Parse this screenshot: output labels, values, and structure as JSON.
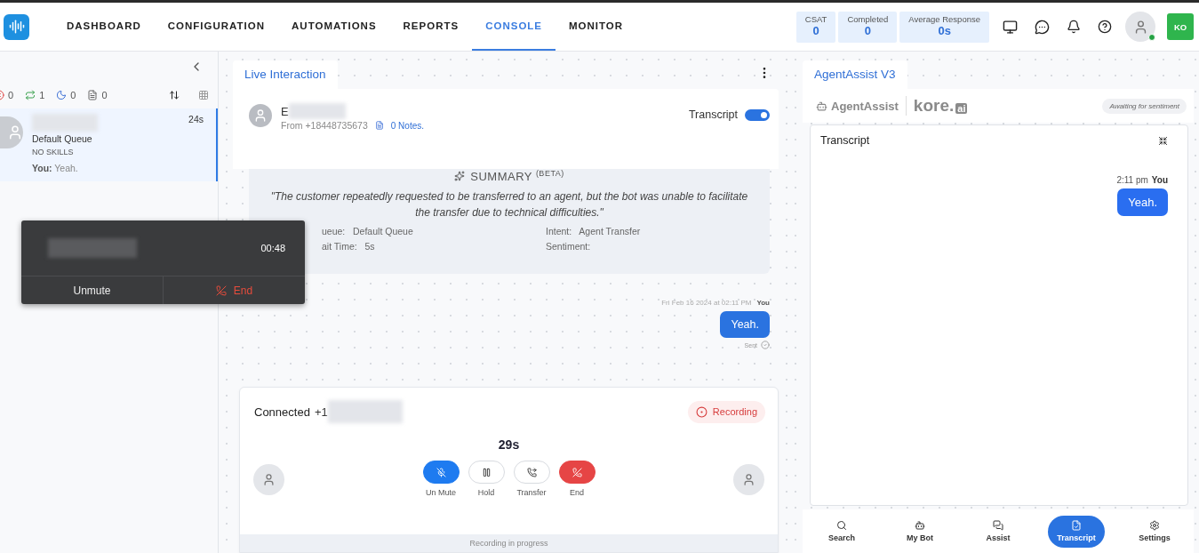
{
  "nav": {
    "items": [
      {
        "label": "DASHBOARD",
        "selected": false
      },
      {
        "label": "CONFIGURATION",
        "selected": false
      },
      {
        "label": "AUTOMATIONS",
        "selected": false
      },
      {
        "label": "REPORTS",
        "selected": false
      },
      {
        "label": "CONSOLE",
        "selected": true
      },
      {
        "label": "MONITOR",
        "selected": false
      }
    ],
    "stats": [
      {
        "label": "CSAT",
        "value": "0"
      },
      {
        "label": "Completed",
        "value": "0"
      },
      {
        "label": "Average Response",
        "value": "0s"
      }
    ],
    "user": {
      "online": true,
      "initials": "KO"
    }
  },
  "queue_panel": {
    "counts": [
      {
        "kind": "missed",
        "value": "0"
      },
      {
        "kind": "transfer",
        "value": "1"
      },
      {
        "kind": "away",
        "value": "0"
      },
      {
        "kind": "notes",
        "value": "0"
      }
    ],
    "conversations": [
      {
        "time": "24s",
        "queue": "Default Queue",
        "skills": "NO SKILLS",
        "last_sender": "You:",
        "last_message": "Yeah.",
        "selected": true
      }
    ]
  },
  "call_widget": {
    "timer": "00:48",
    "buttons": [
      {
        "kind": "mute",
        "label": "Unmute"
      },
      {
        "kind": "end",
        "label": "End"
      }
    ]
  },
  "interaction": {
    "tab": "Live Interaction",
    "contact": {
      "name": "E",
      "from": "From +18448735673",
      "notes": "0 Notes."
    },
    "transcript_toggle": {
      "label": "Transcript",
      "on": true
    },
    "summary": {
      "title": "SUMMARY $^{(BETA)}$",
      "text": "\"The customer repeatedly requested to be transferred to an agent, but the bot was unable to facilitate the transfer due to technical difficulties.\"",
      "fields": [
        {
          "label": "ueue:",
          "value": "Default Queue"
        },
        {
          "label": "Intent:",
          "value": "Agent Transfer"
        },
        {
          "label": "ait Time:",
          "value": "5s"
        },
        {
          "label": "Sentiment:"
        }
      ]
    },
    "message": {
      "timestamp": "Fri Feb 16 2024 at 02:11 PM",
      "sender": "You",
      "text": "Yeah.",
      "status": "Sent"
    },
    "call": {
      "status": "Connected",
      "number": "+1",
      "recording": "Recording",
      "duration": "29s",
      "controls": [
        {
          "kind": "mute",
          "label": "Un Mute",
          "active": true
        },
        {
          "kind": "hold",
          "label": "Hold",
          "active": false
        },
        {
          "kind": "transfer",
          "label": "Transfer",
          "active": false
        },
        {
          "kind": "end",
          "label": "End",
          "active": false
        }
      ],
      "footer": "Recording in progress"
    }
  },
  "assist": {
    "tab": "AgentAssist V3",
    "brand": "AgentAssist",
    "logo": "kore.",
    "logo_suffix": "ai",
    "sentiment": "Awaiting for sentiment",
    "transcript": {
      "title": "Transcript",
      "time": "2:11 pm",
      "sender": "You",
      "text": "Yeah."
    },
    "bottom_nav": [
      {
        "kind": "search",
        "label": "Search",
        "selected": false
      },
      {
        "kind": "bot",
        "label": "My Bot",
        "selected": false
      },
      {
        "kind": "assist",
        "label": "Assist",
        "selected": false
      },
      {
        "kind": "transcript",
        "label": "Transcript",
        "selected": true
      },
      {
        "kind": "settings",
        "label": "Settings",
        "selected": false
      }
    ]
  }
}
